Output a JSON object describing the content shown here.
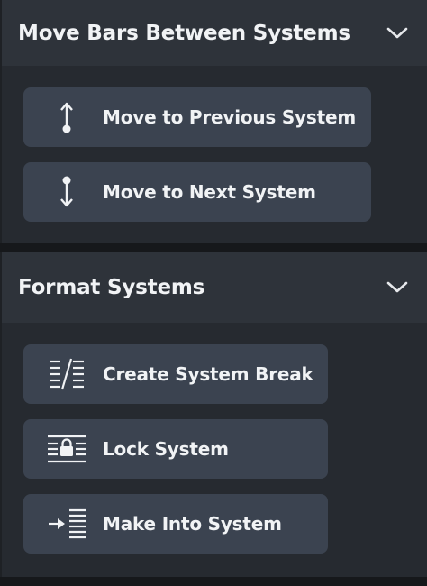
{
  "sections": [
    {
      "title": "Move Bars Between Systems",
      "expanded": true,
      "buttons": [
        {
          "label": "Move to Previous System",
          "icon": "arrow-up-from-dot-icon"
        },
        {
          "label": "Move to Next System",
          "icon": "arrow-down-from-dot-icon"
        }
      ]
    },
    {
      "title": "Format Systems",
      "expanded": true,
      "buttons": [
        {
          "label": "Create System Break",
          "icon": "system-break-icon"
        },
        {
          "label": "Lock System",
          "icon": "lock-system-icon"
        },
        {
          "label": "Make Into System",
          "icon": "make-into-system-icon"
        }
      ]
    }
  ],
  "colors": {
    "header_bg": "#2e333a",
    "body_bg": "#262a30",
    "button_bg": "#3b4350",
    "text": "#f1f3f5"
  }
}
